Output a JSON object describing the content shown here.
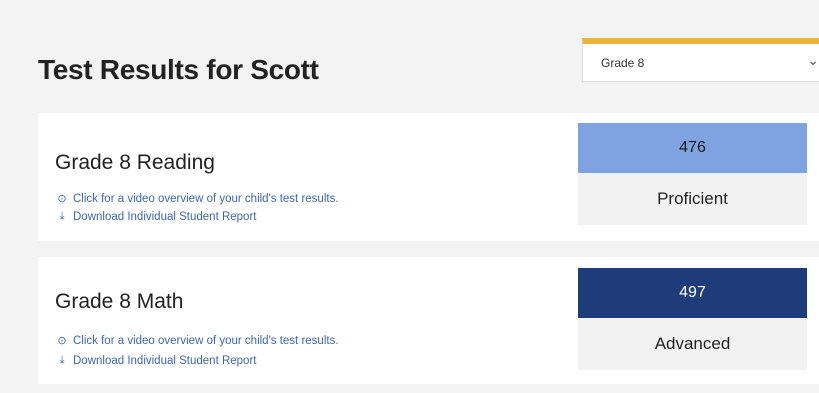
{
  "header": {
    "title": "Test Results for Scott"
  },
  "grade_select": {
    "selected": "Grade 8",
    "accent_color": "#e7b53a"
  },
  "results": [
    {
      "title": "Grade 8 Reading",
      "video_link": "Click for a video overview of your child's test results.",
      "download_link": "Download Individual Student Report",
      "score": "476",
      "level": "Proficient",
      "score_color": "#7ea3e0"
    },
    {
      "title": "Grade 8 Math",
      "video_link": "Click for a video overview of your child's test results.",
      "download_link": "Download Individual Student Report",
      "score": "497",
      "level": "Advanced",
      "score_color": "#1e3b7a"
    }
  ],
  "icons": {
    "video": "play-circle-icon",
    "download": "download-icon",
    "dropdown": "chevron-down-icon"
  }
}
